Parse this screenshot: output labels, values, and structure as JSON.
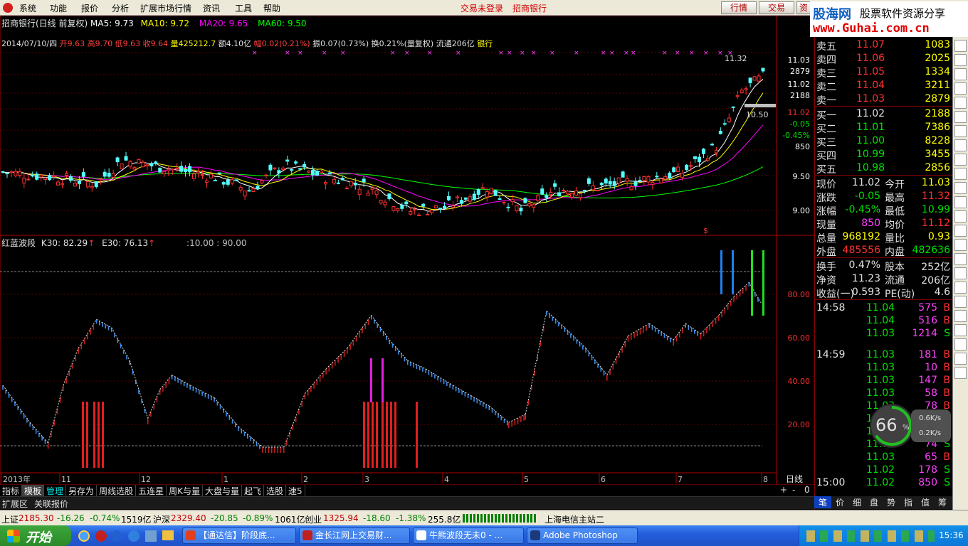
{
  "menu": {
    "items": [
      "系统",
      "功能",
      "报价",
      "分析",
      "扩展市场行情",
      "资讯",
      "工具",
      "帮助"
    ],
    "status_trade": "交易未登录",
    "stock_name": "招商银行",
    "btn_quote": "行情",
    "btn_trade": "交易",
    "btn_more": "资"
  },
  "watermark": {
    "brand": "股海网",
    "tagline": "股票软件资源分享",
    "url": "www.Guhai.com.cn"
  },
  "info": {
    "title": "招商银行(日线 前复权)",
    "ma5": "MA5: 9.73",
    "ma10": "MA10: 9.72",
    "ma20": "MA20: 9.65",
    "ma60": "MA60: 9.50",
    "bar_date": "2014/07/10/四",
    "open": "开9.63",
    "high": "高9.70",
    "low": "低9.63",
    "close": "收9.64",
    "volume": "量425212.7",
    "amount": "额4.10亿",
    "change": "幅0.02(0.21%)",
    "amplitude": "振0.07(0.73%)",
    "turnover": "换0.21%(量复权)",
    "float": "流通206亿",
    "sector": "银行"
  },
  "price_axis": {
    "labels": [
      "11.03",
      "2879",
      "11.02",
      "2188",
      "11.02",
      "-0.05",
      "-0.45%",
      "850",
      "9.50",
      "9.00"
    ],
    "high_mark": "11.32",
    "low_mark": "10.50"
  },
  "indicator": {
    "title": "红蓝波段",
    "k30": "K30: 82.29",
    "e30": "E30: 76.13",
    "range": ":10.00 : 90.00",
    "axis": [
      "80.00",
      "60.00",
      "40.00",
      "20.00"
    ]
  },
  "date_axis": {
    "labels": [
      "2013年",
      "11",
      "12",
      "1",
      "2",
      "3",
      "4",
      "5",
      "6",
      "7",
      "8"
    ],
    "period": "日线"
  },
  "tabs": [
    "指标",
    "模板",
    "管理",
    "另存为",
    "周线选股",
    "五连星",
    "周K与量",
    "大盘与量",
    "起飞",
    "选股",
    "速5"
  ],
  "tabs_right": [
    "+",
    "-",
    "0"
  ],
  "ext_tabs": [
    "扩展区",
    "关联报价"
  ],
  "order_book": {
    "asks": [
      {
        "label": "卖五",
        "price": "11.07",
        "vol": "1083"
      },
      {
        "label": "卖四",
        "price": "11.06",
        "vol": "2025"
      },
      {
        "label": "卖三",
        "price": "11.05",
        "vol": "1334"
      },
      {
        "label": "卖二",
        "price": "11.04",
        "vol": "3211"
      },
      {
        "label": "卖一",
        "price": "11.03",
        "vol": "2879"
      }
    ],
    "bids": [
      {
        "label": "买一",
        "price": "11.02",
        "vol": "2188"
      },
      {
        "label": "买二",
        "price": "11.01",
        "vol": "7386"
      },
      {
        "label": "买三",
        "price": "11.00",
        "vol": "8228"
      },
      {
        "label": "买四",
        "price": "10.99",
        "vol": "3455"
      },
      {
        "label": "买五",
        "price": "10.98",
        "vol": "2856"
      }
    ]
  },
  "quote": [
    {
      "l1": "现价",
      "v1": "11.02",
      "l2": "今开",
      "v2": "11.03"
    },
    {
      "l1": "涨跌",
      "v1": "-0.05",
      "l2": "最高",
      "v2": "11.32"
    },
    {
      "l1": "涨幅",
      "v1": "-0.45%",
      "l2": "最低",
      "v2": "10.99"
    },
    {
      "l1": "现量",
      "v1": "850",
      "l2": "均价",
      "v2": "11.12"
    },
    {
      "l1": "总量",
      "v1": "968192",
      "l2": "量比",
      "v2": "0.93"
    },
    {
      "l1": "外盘",
      "v1": "485556",
      "l2": "内盘",
      "v2": "482636"
    }
  ],
  "fund": [
    {
      "l1": "换手",
      "v1": "0.47%",
      "l2": "股本",
      "v2": "252亿"
    },
    {
      "l1": "净资",
      "v1": "11.23",
      "l2": "流通",
      "v2": "206亿"
    },
    {
      "l1": "收益(一)",
      "v1": "0.593",
      "l2": "PE(动)",
      "v2": "4.6"
    }
  ],
  "ticks": [
    {
      "time": "14:58",
      "price": "11.04",
      "vol": "575",
      "bs": "B"
    },
    {
      "time": "",
      "price": "11.04",
      "vol": "516",
      "bs": "B"
    },
    {
      "time": "",
      "price": "11.03",
      "vol": "1214",
      "bs": "S"
    },
    {
      "time": "14:59",
      "price": "11.03",
      "vol": "181",
      "bs": "B"
    },
    {
      "time": "",
      "price": "11.03",
      "vol": "10",
      "bs": "B"
    },
    {
      "time": "",
      "price": "11.03",
      "vol": "147",
      "bs": "B"
    },
    {
      "time": "",
      "price": "11.03",
      "vol": "58",
      "bs": "B"
    },
    {
      "time": "",
      "price": "11.03",
      "vol": "78",
      "bs": "B"
    },
    {
      "time": "",
      "price": "11.02",
      "vol": "",
      "bs": ""
    },
    {
      "time": "",
      "price": "11.03",
      "vol": "",
      "bs": ""
    },
    {
      "time": "",
      "price": "11.02",
      "vol": "74",
      "bs": "S"
    },
    {
      "time": "",
      "price": "11.03",
      "vol": "65",
      "bs": "B"
    },
    {
      "time": "",
      "price": "11.02",
      "vol": "178",
      "bs": "S"
    },
    {
      "time": "15:00",
      "price": "11.02",
      "vol": "850",
      "bs": "S"
    }
  ],
  "right_tabs": [
    "笔",
    "价",
    "细",
    "盘",
    "势",
    "指",
    "值",
    "筹"
  ],
  "gauge": {
    "percent": "66",
    "up": "0.6K/s",
    "down": "0.2K/s"
  },
  "statusbar": {
    "sh": "上证",
    "sh_val": "2185.30",
    "sh_chg": "-16.26",
    "sh_pct": "-0.74%",
    "sh_amt": "1519亿",
    "sz": "沪深",
    "sz_val": "2329.40",
    "sz_chg": "-20.85",
    "sz_pct": "-0.89%",
    "sz_amt": "1061亿",
    "cy": "创业",
    "cy_val": "1325.94",
    "cy_chg": "-18.60",
    "cy_pct": "-1.38%",
    "cy_amt": "255.8亿",
    "server": "上海电信主站二"
  },
  "taskbar": {
    "start": "开始",
    "tasks": [
      "【通达信】阶段底...",
      "金长江网上交易财...",
      "牛熊波段无未0 - ...",
      "Adobe Photoshop"
    ],
    "clock": "15:36"
  },
  "colors": {
    "up": "#ff3030",
    "down": "#54ffff",
    "ma5": "#ffffff",
    "ma10": "#ffff00",
    "ma20": "#ff00ff",
    "ma60": "#00ff00",
    "band_red": "#c81e1e",
    "band_blue": "#3c8ce6"
  }
}
